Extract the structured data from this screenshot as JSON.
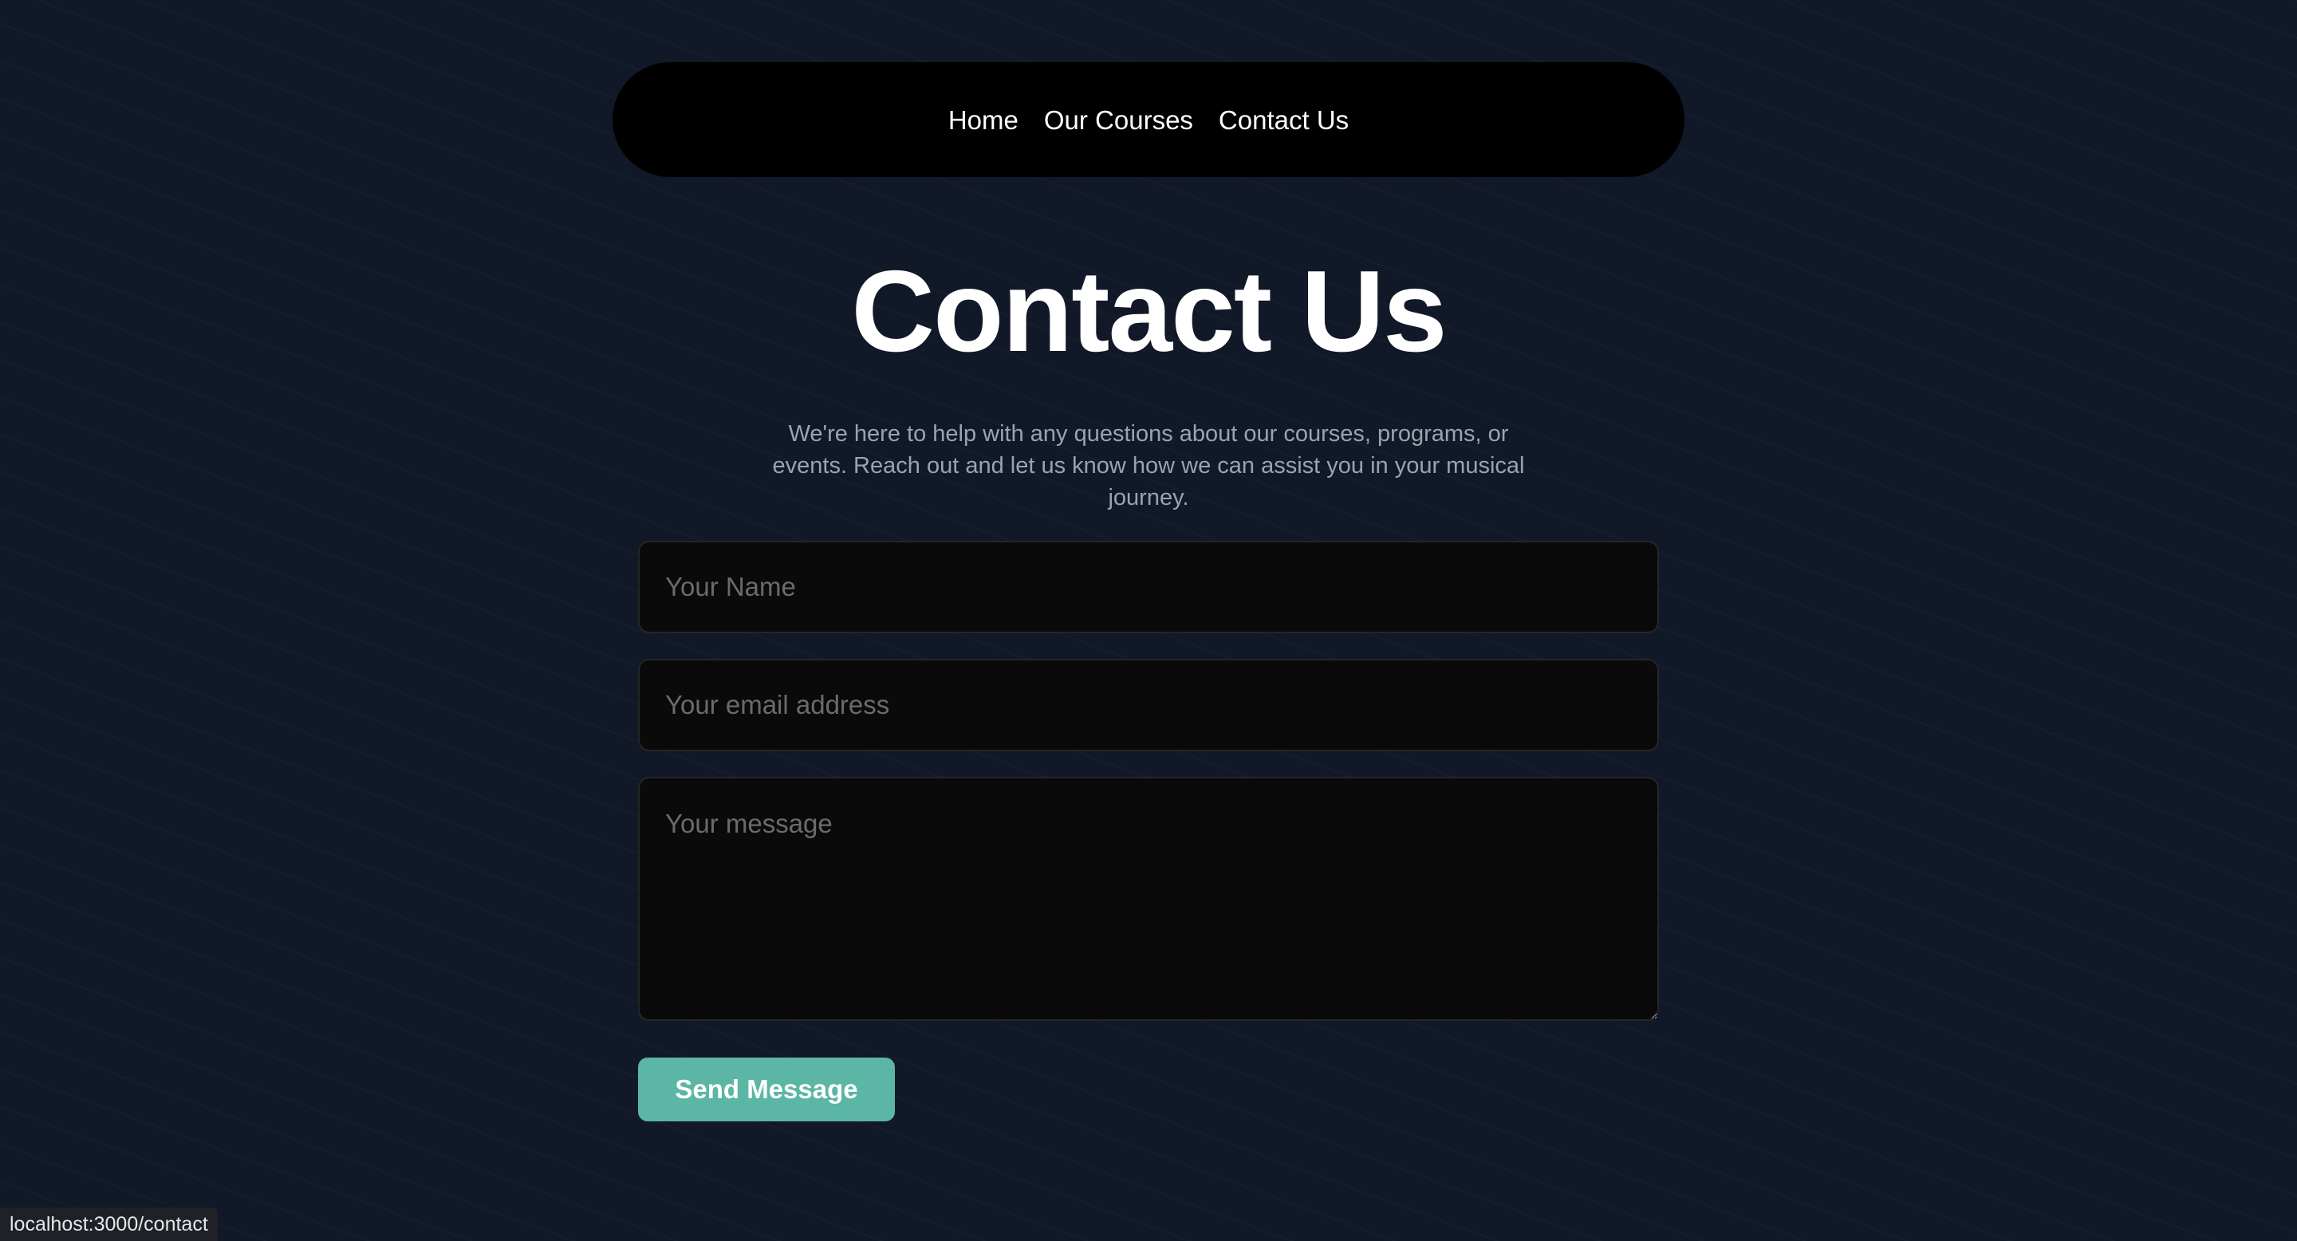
{
  "nav": {
    "items": [
      {
        "label": "Home"
      },
      {
        "label": "Our Courses"
      },
      {
        "label": "Contact Us"
      }
    ]
  },
  "page": {
    "title": "Contact Us",
    "intro": "We're here to help with any questions about our courses, programs, or events. Reach out and let us know how we can assist you in your musical journey."
  },
  "form": {
    "name": {
      "placeholder": "Your Name",
      "value": ""
    },
    "email": {
      "placeholder": "Your email address",
      "value": ""
    },
    "message": {
      "placeholder": "Your message",
      "value": ""
    },
    "submit_label": "Send Message"
  },
  "status_bar": {
    "url": "localhost:3000/contact"
  },
  "colors": {
    "background": "#111827",
    "navbar": "#000000",
    "accent": "#5bb6a5",
    "field_background": "#0a0a0a"
  }
}
